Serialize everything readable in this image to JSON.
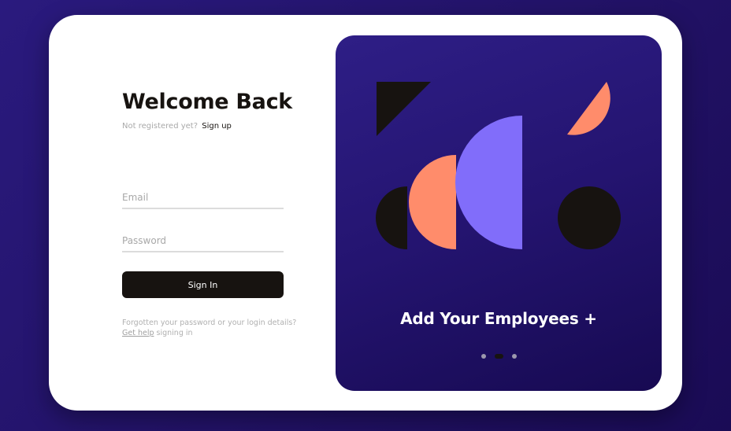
{
  "login": {
    "title": "Welcome Back",
    "not_registered": "Not registered yet?",
    "signup_link": "Sign up",
    "email_placeholder": "Email",
    "password_placeholder": "Password",
    "signin_label": "Sign In",
    "forgot_text": "Forgotten your password or your login details?",
    "help_link": "Get help",
    "help_suffix": "signing in"
  },
  "carousel": {
    "caption": "Add Your Employees +",
    "slide_count": 3,
    "active_index": 1
  },
  "colors": {
    "background": "#221266",
    "card": "#ffffff",
    "panel": "#241470",
    "dark": "#171310",
    "coral": "#ff8c6b",
    "violet": "#816dfa"
  }
}
